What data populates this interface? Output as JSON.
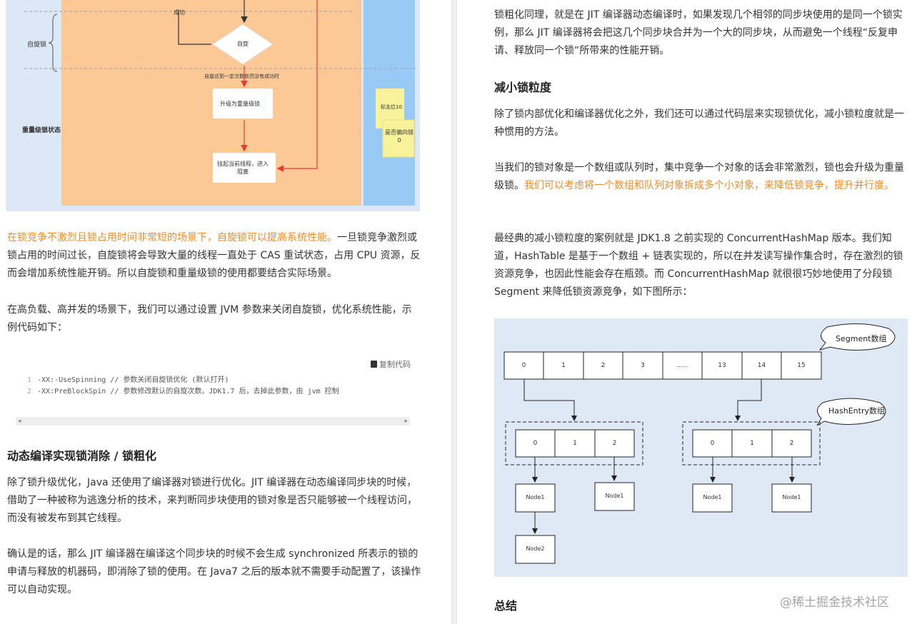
{
  "left": {
    "flow_diagram": {
      "label_success": "成功",
      "label_spin_lock": "自旋锁",
      "label_spin": "自旋",
      "label_spin_limit": "自旋达到一定次数依然没有成功时",
      "label_upgrade": "升级为重量级锁",
      "label_heavy_state": "重量级锁状态",
      "label_suspend": "挂起当前线程，进入阻塞",
      "note_flag": "标志位10",
      "note_biased": "是否偏向锁 0"
    },
    "para1_highlight": "在锁竞争不激烈且锁占用时间非常短的场景下，自旋锁可以提高系统性能。",
    "para1_rest": "一旦锁竞争激烈或锁占用的时间过长，自旋锁将会导致大量的线程一直处于 CAS 重试状态，占用 CPU 资源，反而会增加系统性能开销。所以自旋锁和重量级锁的使用都要结合实际场景。",
    "para2": "在高负载、高并发的场景下，我们可以通过设置 JVM 参数来关闭自旋锁，优化系统性能，示例代码如下：",
    "copy_label": "复制代码",
    "code_lines": [
      {
        "num": "1",
        "text": "-XX:-UseSpinning // 参数关闭自旋锁优化 (默认打开)"
      },
      {
        "num": "2",
        "text": "-XX:PreBlockSpin // 参数修改默认的自旋次数。JDK1.7 后，去掉此参数，由 jvm 控制"
      }
    ],
    "heading1": "动态编译实现锁消除 / 锁粗化",
    "para3": "除了锁升级优化，Java 还使用了编译器对锁进行优化。JIT 编译器在动态编译同步块的时候，借助了一种被称为逃逸分析的技术，来判断同步块使用的锁对象是否只能够被一个线程访问，而没有被发布到其它线程。",
    "para4": "确认是的话，那么 JIT 编译器在编译这个同步块的时候不会生成 synchronized 所表示的锁的申请与释放的机器码，即消除了锁的使用。在 Java7 之后的版本就不需要手动配置了，该操作可以自动实现。"
  },
  "right": {
    "para1": "锁粗化同理，就是在 JIT 编译器动态编译时，如果发现几个相邻的同步块使用的是同一个锁实例，那么 JIT 编译器将会把这几个同步块合并为一个大的同步块，从而避免一个线程“反复申请、释放同一个锁“所带来的性能开销。",
    "heading1": "减小锁粒度",
    "para2": "除了锁内部优化和编译器优化之外，我们还可以通过代码层来实现锁优化，减小锁粒度就是一种惯用的方法。",
    "para3_plain": "当我们的锁对象是一个数组或队列时，集中竞争一个对象的话会非常激烈，锁也会升级为重量级锁。",
    "para3_highlight": "我们可以考虑将一个数组和队列对象拆成多个小对象，来降低锁竞争，提升并行度。",
    "para4": "最经典的减小锁粒度的案例就是 JDK1.8 之前实现的 ConcurrentHashMap 版本。我们知道，HashTable 是基于一个数组 + 链表实现的，所以在并发读写操作集合时，存在激烈的锁资源竞争，也因此性能会存在瓶颈。而 ConcurrentHashMap 就很很巧妙地使用了分段锁 Segment 来降低锁资源竞争，如下图所示：",
    "segment_diagram": {
      "callout_segment": "Segment数组",
      "callout_hashentry": "HashEntry数组",
      "segments": [
        "0",
        "1",
        "2",
        "3",
        "......",
        "13",
        "14",
        "15"
      ],
      "entries_left": [
        "0",
        "1",
        "2"
      ],
      "entries_right": [
        "0",
        "1",
        "2"
      ],
      "node1": "Node1",
      "node2": "Node2"
    },
    "heading2": "总结",
    "watermark": "@稀土掘金技术社区"
  }
}
